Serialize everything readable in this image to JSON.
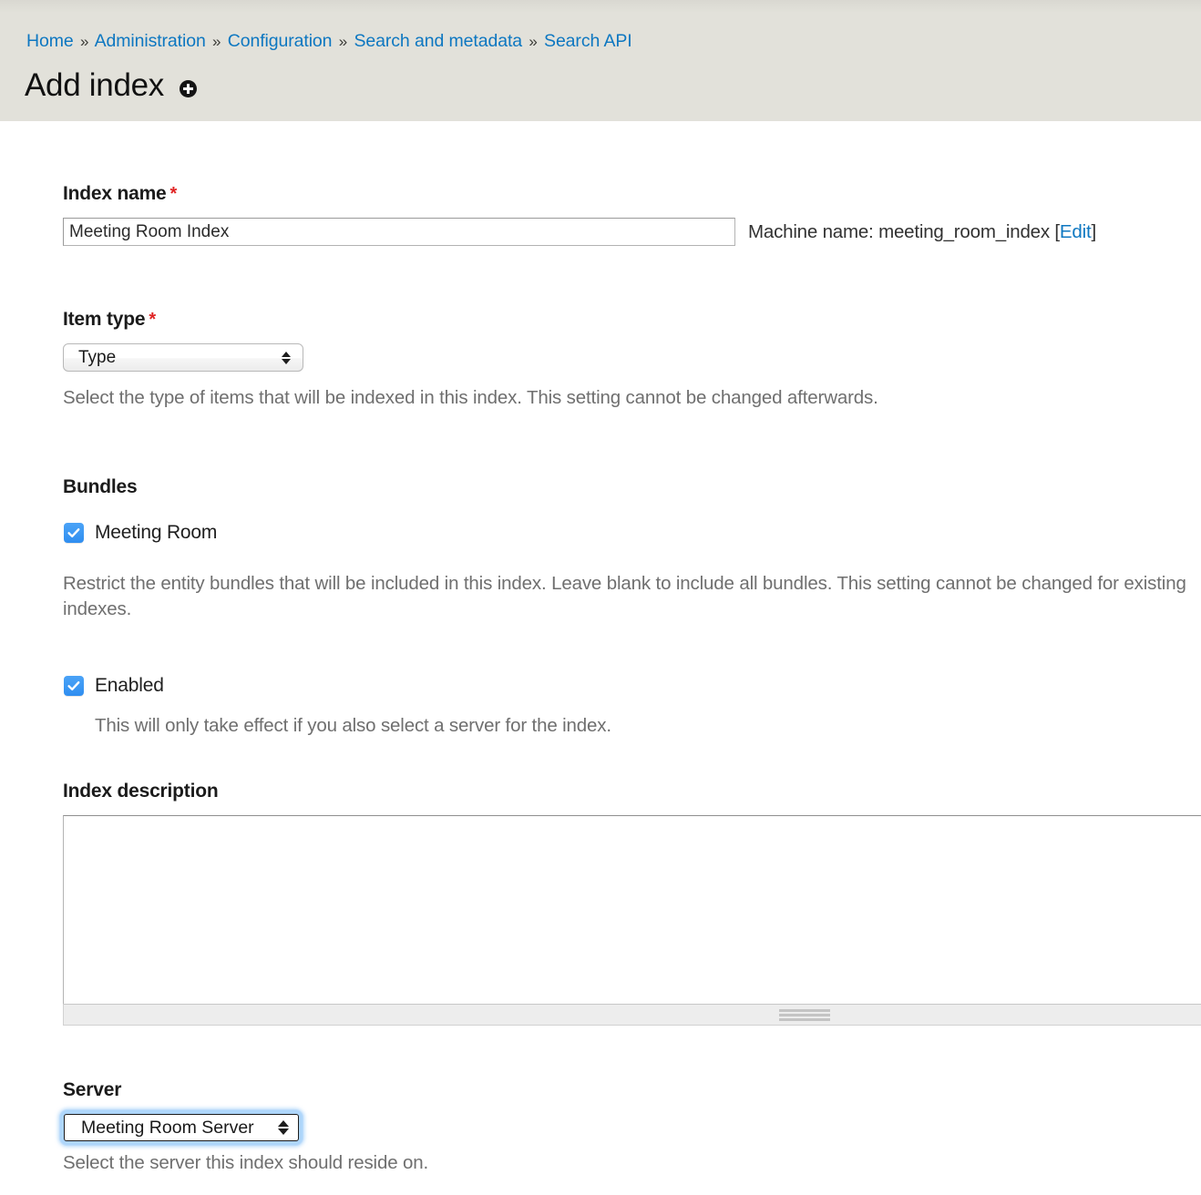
{
  "header": {
    "breadcrumb": [
      {
        "label": "Home",
        "link": true
      },
      {
        "label": "Administration",
        "link": true
      },
      {
        "label": "Configuration",
        "link": true
      },
      {
        "label": "Search and metadata",
        "link": true
      },
      {
        "label": "Search API",
        "link": true
      }
    ],
    "separator": "»",
    "title": "Add index",
    "title_icon": "add-circle-icon",
    "background_color": "#e2e1da",
    "link_color": "#0d77c1"
  },
  "form": {
    "index_name": {
      "label": "Index name",
      "required_mark": "*",
      "value": "Meeting Room Index",
      "placeholder": "",
      "machine_name_prefix": "Machine name: ",
      "machine_name_value": "meeting_room_index",
      "machine_name_bracket_open": " [",
      "machine_name_edit_label": "Edit",
      "machine_name_bracket_close": "]"
    },
    "item_type": {
      "label": "Item type",
      "required_mark": "*",
      "selected": "Type",
      "description": "Select the type of items that will be indexed in this index. This setting cannot be changed afterwards."
    },
    "bundles": {
      "heading": "Bundles",
      "items": [
        {
          "label": "Meeting Room",
          "checked": true
        }
      ],
      "description": "Restrict the entity bundles that will be included in this index. Leave blank to include all bundles. This setting cannot be changed for existing indexes."
    },
    "enabled": {
      "label": "Enabled",
      "checked": true,
      "description": "This will only take effect if you also select a server for the index."
    },
    "index_description": {
      "label": "Index description",
      "value": "",
      "placeholder": ""
    },
    "server": {
      "label": "Server",
      "selected": "Meeting Room Server",
      "description": "Select the server this index should reside on.",
      "focused": true,
      "focus_ring_color": "#aed6fb"
    }
  }
}
